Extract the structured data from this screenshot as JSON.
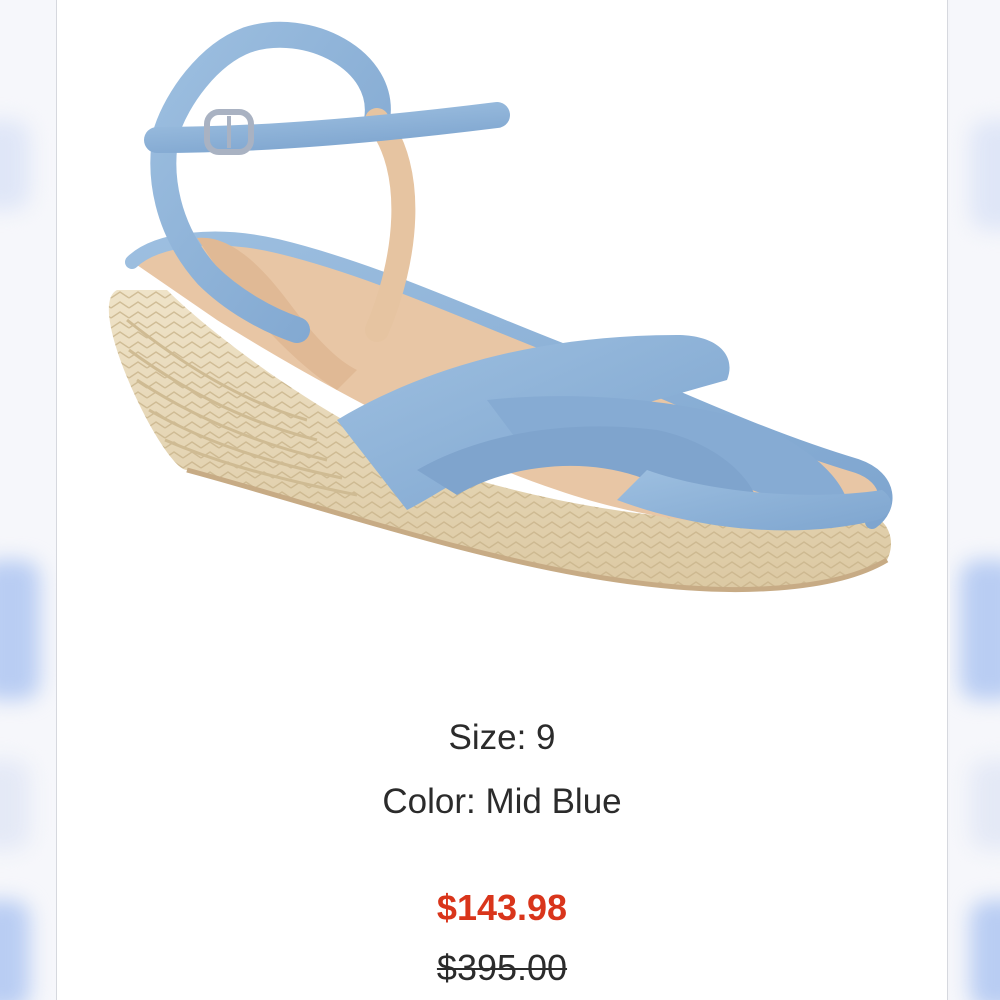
{
  "product": {
    "image_alt": "light blue denim espadrille wedge sandal with ankle strap",
    "size_label": "Size:",
    "size_value": "9",
    "color_label": "Color:",
    "color_value": "Mid Blue",
    "sale_price": "$143.98",
    "original_price": "$395.00"
  },
  "colors": {
    "sale_price": "#d9351b",
    "text": "#2b2b2b",
    "denim": "#8fb3d6",
    "jute": "#e6d7b8"
  }
}
